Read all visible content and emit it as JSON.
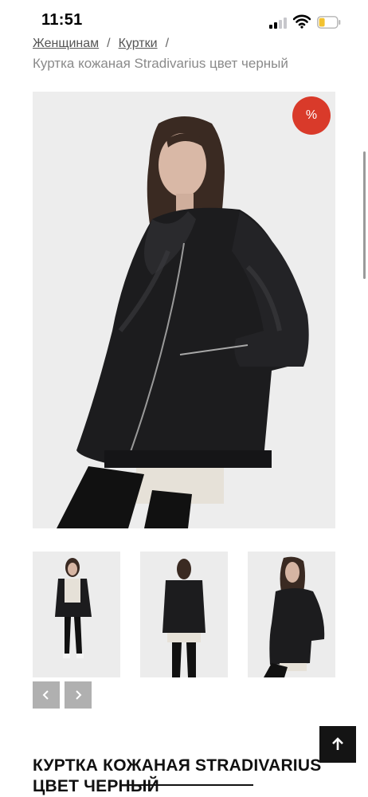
{
  "status_bar": {
    "time": "11:51"
  },
  "breadcrumb": {
    "items": [
      "Женщинам",
      "Куртки"
    ],
    "separator": "/",
    "current": "Куртка кожаная Stradivarius цвет черный"
  },
  "gallery": {
    "badge": "%",
    "badge_color": "#d93a2a",
    "prev_icon": "chevron-left-icon",
    "next_icon": "chevron-right-icon"
  },
  "product": {
    "title": "КУРТКА КОЖАНАЯ STRADIVARIUS ЦВЕТ ЧЕРНЫЙ"
  },
  "scroll_to_top_icon": "arrow-up-icon"
}
